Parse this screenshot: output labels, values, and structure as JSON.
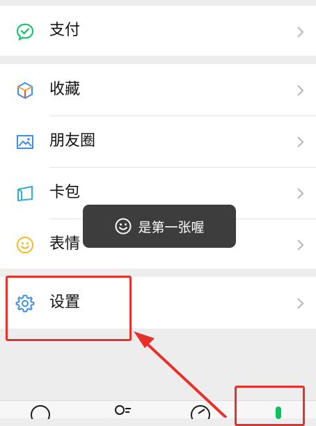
{
  "menu": {
    "pay": {
      "label": "支付",
      "icon": "wallet-check-icon"
    },
    "favorites": {
      "label": "收藏",
      "icon": "cube-icon"
    },
    "moments": {
      "label": "朋友圈",
      "icon": "picture-icon"
    },
    "cards": {
      "label": "卡包",
      "icon": "card-wallet-icon"
    },
    "stickers": {
      "label": "表情",
      "icon": "smiley-icon"
    },
    "settings": {
      "label": "设置",
      "icon": "gear-icon"
    }
  },
  "toast": {
    "text": "是第一张喔",
    "icon": "smiley-icon"
  },
  "tabbar": {
    "items": [
      {
        "icon": "chat-icon"
      },
      {
        "icon": "contacts-icon"
      },
      {
        "icon": "discover-compass-icon"
      },
      {
        "icon": "me-icon",
        "active": true
      }
    ]
  },
  "colors": {
    "accent_green": "#07c160",
    "annotation_red": "#e8302a",
    "toast_bg": "#2c2c2c"
  }
}
